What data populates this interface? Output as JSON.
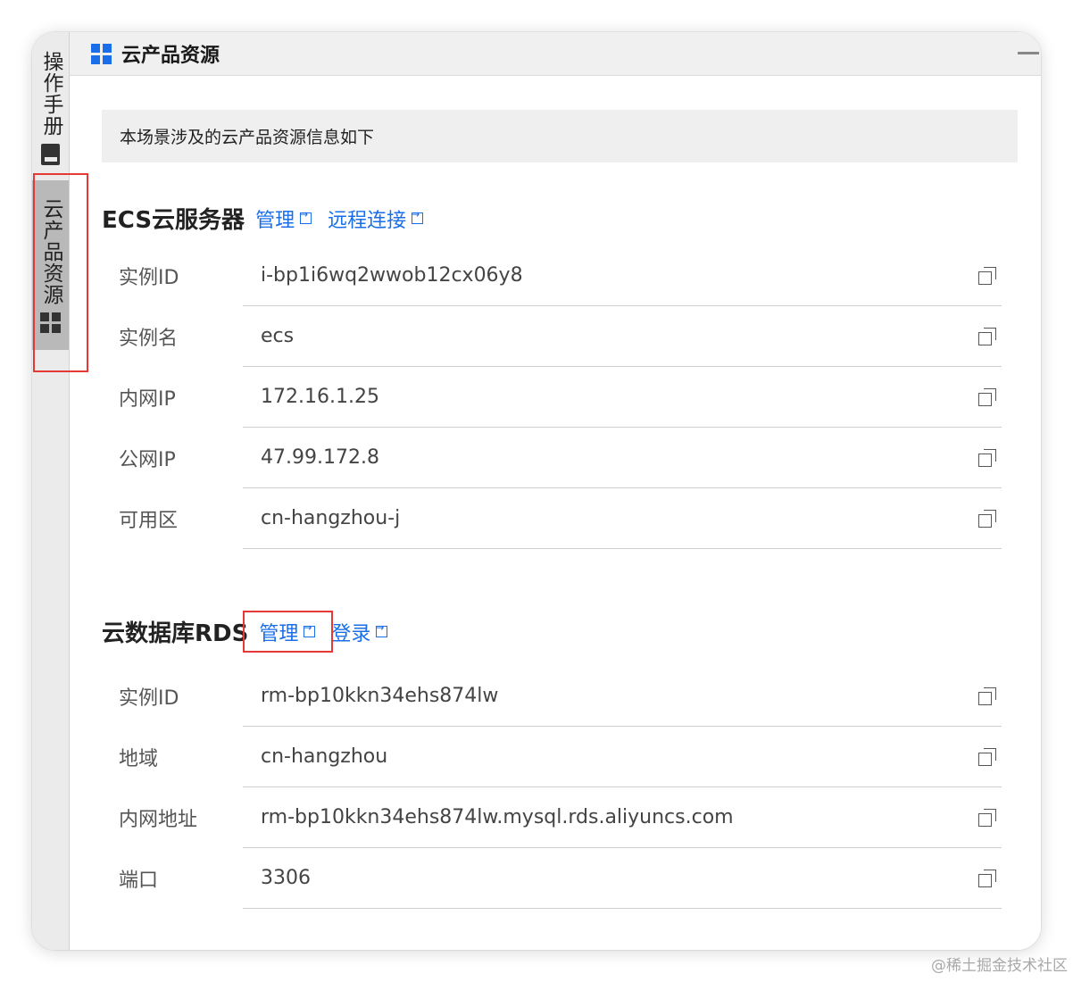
{
  "sidebar": {
    "tabs": [
      {
        "label": "操作手册",
        "icon": "book-icon"
      },
      {
        "label": "云产品资源",
        "icon": "grid-icon",
        "active": true
      }
    ]
  },
  "header": {
    "title": "云产品资源",
    "icon": "grid-icon"
  },
  "notice": "本场景涉及的云产品资源信息如下",
  "ecs": {
    "title": "ECS云服务器",
    "links": [
      "管理",
      "远程连接"
    ],
    "rows": [
      {
        "label": "实例ID",
        "value": "i-bp1i6wq2wwob12cx06y8"
      },
      {
        "label": "实例名",
        "value": "ecs"
      },
      {
        "label": "内网IP",
        "value": "172.16.1.25"
      },
      {
        "label": "公网IP",
        "value": "47.99.172.8"
      },
      {
        "label": "可用区",
        "value": "cn-hangzhou-j"
      }
    ]
  },
  "rds": {
    "title": "云数据库RDS",
    "links": [
      "管理",
      "登录"
    ],
    "rows": [
      {
        "label": "实例ID",
        "value": "rm-bp10kkn34ehs874lw"
      },
      {
        "label": "地域",
        "value": "cn-hangzhou"
      },
      {
        "label": "内网地址",
        "value": "rm-bp10kkn34ehs874lw.mysql.rds.aliyuncs.com"
      },
      {
        "label": "端口",
        "value": "3306"
      }
    ]
  },
  "watermark": "@稀土掘金技术社区",
  "colors": {
    "accent": "#1a6ee8",
    "highlight_box": "#e53935"
  }
}
